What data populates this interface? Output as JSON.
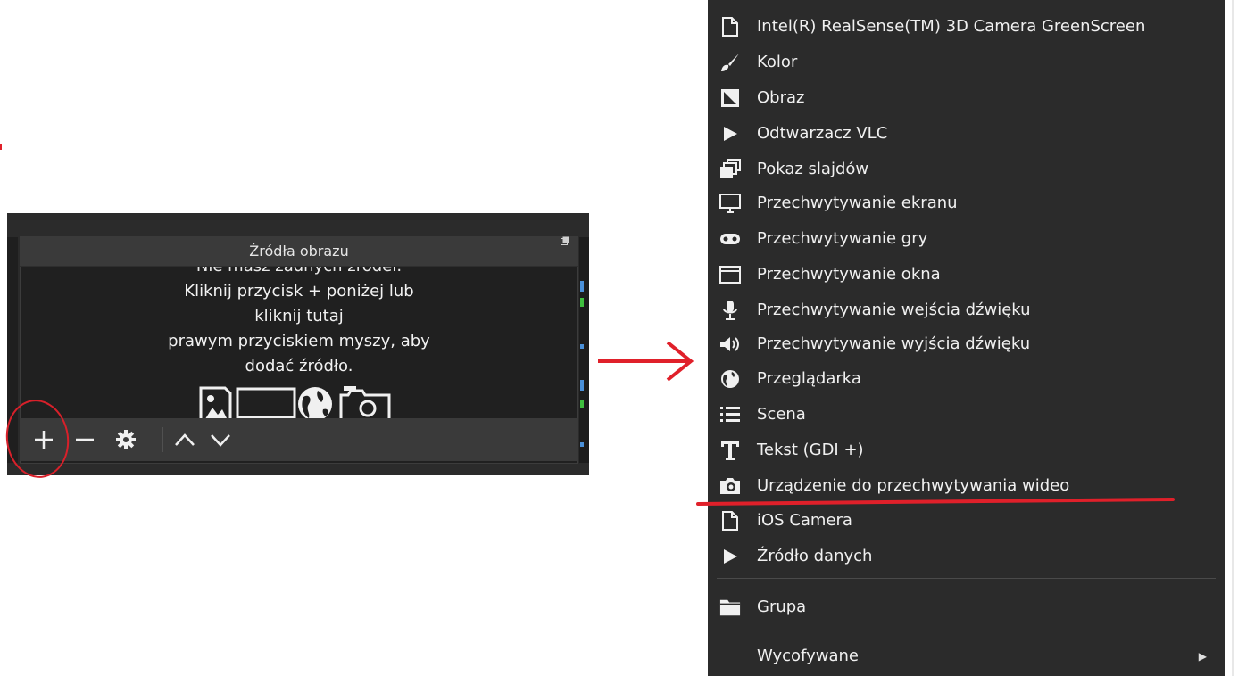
{
  "colors": {
    "annotation": "#e0202a",
    "panel_bg": "#2b2b2b",
    "menu_bg": "#2b2b2b",
    "text": "#f0f0f0"
  },
  "sources_panel": {
    "title": "Źródła obrazu",
    "empty_message": {
      "partial_line": "Nie masz żadnych źródeł.",
      "line1": "Kliknij przycisk + poniżej lub",
      "line2": "kliknij tutaj",
      "line3": "prawym przyciskiem myszy, aby",
      "line4": "dodać źródło."
    },
    "icons": [
      "image-icon",
      "monitor-icon",
      "globe-icon",
      "camera-icon"
    ],
    "toolbar": [
      "add-icon",
      "remove-icon",
      "gear-icon",
      "move-up-icon",
      "move-down-icon"
    ]
  },
  "context_menu": {
    "items": [
      {
        "label": "Intel(R) RealSense(TM) 3D Camera GreenScreen",
        "icon": "document-icon"
      },
      {
        "label": "Kolor",
        "icon": "brush-icon"
      },
      {
        "label": "Obraz",
        "icon": "image-icon"
      },
      {
        "label": "Odtwarzacz VLC",
        "icon": "play-icon"
      },
      {
        "label": "Pokaz slajdów",
        "icon": "slides-icon"
      },
      {
        "label": "Przechwytywanie ekranu",
        "icon": "monitor-icon"
      },
      {
        "label": "Przechwytywanie gry",
        "icon": "gamepad-icon"
      },
      {
        "label": "Przechwytywanie okna",
        "icon": "window-icon"
      },
      {
        "label": "Przechwytywanie wejścia dźwięku",
        "icon": "microphone-icon"
      },
      {
        "label": "Przechwytywanie wyjścia dźwięku",
        "icon": "speaker-icon"
      },
      {
        "label": "Przeglądarka",
        "icon": "globe-icon"
      },
      {
        "label": "Scena",
        "icon": "list-icon"
      },
      {
        "label": "Tekst (GDI +)",
        "icon": "text-icon"
      },
      {
        "label": "Urządzenie do przechwytywania wideo",
        "icon": "camera-icon"
      },
      {
        "label": "iOS Camera",
        "icon": "document-icon"
      },
      {
        "label": "Źródło danych",
        "icon": "play-icon"
      },
      {
        "label": "Grupa",
        "icon": "folder-icon"
      },
      {
        "label": "Wycofywane",
        "icon": "none"
      }
    ]
  }
}
